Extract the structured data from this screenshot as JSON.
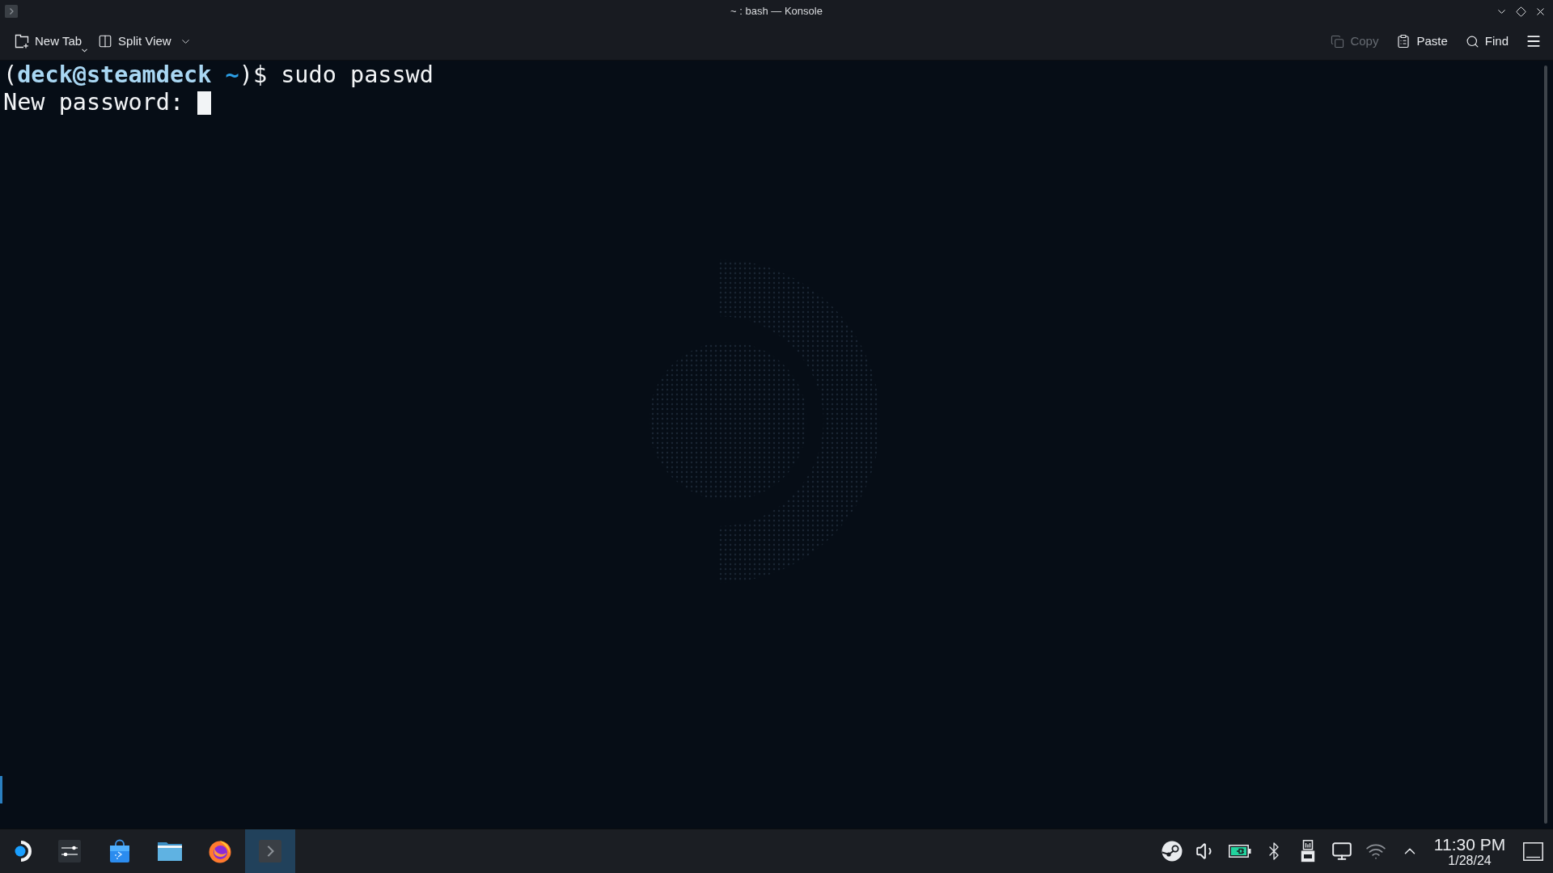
{
  "window": {
    "title": "~ : bash — Konsole"
  },
  "toolbar": {
    "left": [
      {
        "kind": "new_tab",
        "label": "New Tab",
        "disabled": false
      },
      {
        "kind": "split_view",
        "label": "Split View",
        "disabled": false
      }
    ],
    "right": [
      {
        "kind": "copy",
        "label": "Copy",
        "disabled": true
      },
      {
        "kind": "paste",
        "label": "Paste",
        "disabled": false
      },
      {
        "kind": "find",
        "label": "Find",
        "disabled": false
      }
    ]
  },
  "terminal": {
    "lines": [
      {
        "segments": [
          {
            "kind": "plain",
            "text": "("
          },
          {
            "kind": "user",
            "text": "deck@steamdeck"
          },
          {
            "kind": "dir",
            "text": " ~"
          },
          {
            "kind": "plain",
            "text": ")$ sudo passwd"
          }
        ],
        "cursor": false
      },
      {
        "segments": [
          {
            "kind": "plain",
            "text": "New password: "
          }
        ],
        "cursor": true
      }
    ]
  },
  "taskbar": {
    "apps": [
      {
        "kind": "launcher",
        "selected": false
      },
      {
        "kind": "settings",
        "selected": false
      },
      {
        "kind": "store",
        "selected": false
      },
      {
        "kind": "files",
        "selected": false
      },
      {
        "kind": "browser",
        "selected": false
      },
      {
        "kind": "terminal",
        "selected": true
      }
    ],
    "tray": [
      {
        "kind": "steam"
      },
      {
        "kind": "volume"
      },
      {
        "kind": "battery"
      },
      {
        "kind": "bluetooth"
      },
      {
        "kind": "usb"
      },
      {
        "kind": "display"
      },
      {
        "kind": "wifi"
      },
      {
        "kind": "expand"
      }
    ],
    "clock": {
      "time": "11:30 PM",
      "date": "1/28/24"
    }
  }
}
